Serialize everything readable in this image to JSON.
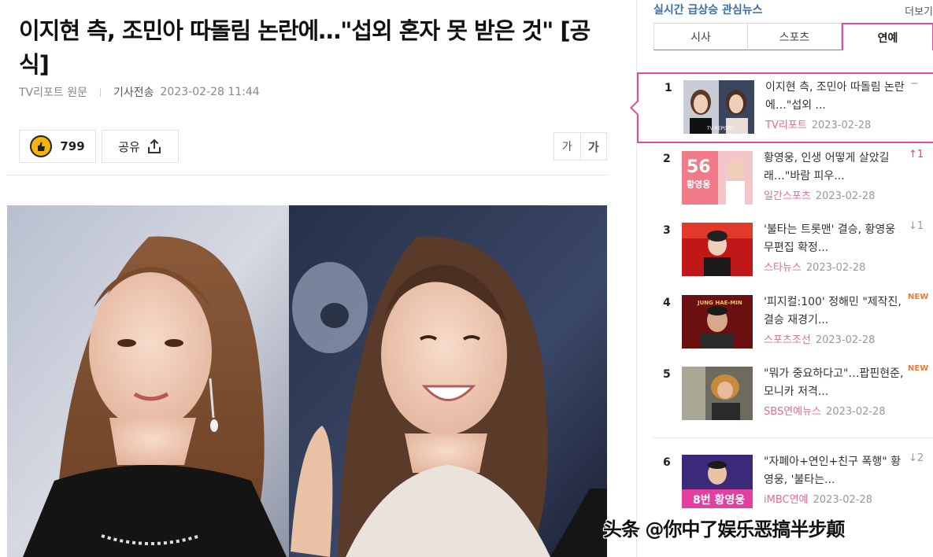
{
  "article": {
    "headline": "이지현 측, 조민아 따돌림 논란에…\"섭외 혼자 못 받은 것\" [공식]",
    "source": "TV리포트 원문",
    "published_label": "기사전송",
    "published_time": "2023-02-28 11:44",
    "like_count": "799",
    "share_label": "공유",
    "font_small": "가",
    "font_large": "가"
  },
  "sidebar": {
    "title": "실시간 급상승 관심뉴스",
    "more": "더보기",
    "tabs": [
      {
        "label": "시사"
      },
      {
        "label": "스포츠"
      },
      {
        "label": "연예"
      }
    ],
    "active_tab": "연예",
    "items": [
      {
        "rank": "1",
        "title": "이지현 측, 조민아 따돌림 논란에…\"섭외 ...",
        "source": "TV리포트",
        "date": "2023-02-28",
        "change": "−",
        "change_type": "same",
        "thumb_text": "TV REPORT"
      },
      {
        "rank": "2",
        "title": "황영웅, 인생 어떻게 살았길래…\"바람 피우...",
        "source": "일간스포츠",
        "date": "2023-02-28",
        "change": "↑1",
        "change_type": "up",
        "thumb_text": "56 황영웅"
      },
      {
        "rank": "3",
        "title": "'불타는 트롯맨' 결승, 황영웅 무편집 확정...",
        "source": "스타뉴스",
        "date": "2023-02-28",
        "change": "↓1",
        "change_type": "down"
      },
      {
        "rank": "4",
        "title": "'피지컬:100' 정해민 \"제작진, 결승 재경기...",
        "source": "스포츠조선",
        "date": "2023-02-28",
        "change": "NEW",
        "change_type": "new",
        "thumb_text": "JUNG HAE-MIN"
      },
      {
        "rank": "5",
        "title": "\"뭐가 중요하다고\"…팝핀현준, 모니카 저격...",
        "source": "SBS연예뉴스",
        "date": "2023-02-28",
        "change": "NEW",
        "change_type": "new"
      },
      {
        "rank": "6",
        "title": "\"자폐아+연인+친구 폭행\" 황영웅, '불타는...",
        "source": "iMBC연예",
        "date": "2023-02-28",
        "change": "↓2",
        "change_type": "down",
        "thumb_text": "8번 황영웅"
      }
    ]
  },
  "watermark": "头条 @你中了娱乐恶搞半步颠",
  "colors": {
    "accent": "#e8499e",
    "source_pink": "#e86a8f",
    "sidebar_title": "#3a6ea8"
  }
}
